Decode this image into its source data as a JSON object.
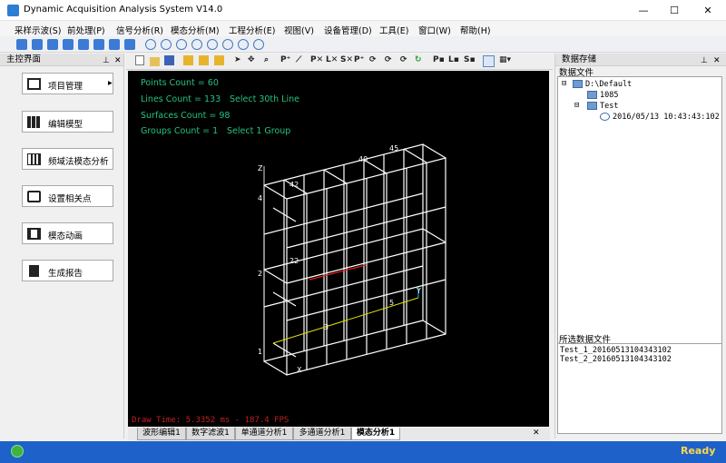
{
  "window": {
    "title": "Dynamic Acquisition Analysis System V14.0",
    "minimize": "—",
    "maximize": "☐",
    "close": "✕"
  },
  "menu": [
    "采样示波(S)",
    "前处理(P)",
    "信号分析(R)",
    "模态分析(M)",
    "工程分析(E)",
    "视图(V)",
    "设备管理(D)",
    "工具(E)",
    "窗口(W)",
    "帮助(H)"
  ],
  "left_panel": {
    "title": "主控界面",
    "pin": "⊥",
    "close": "✕",
    "buttons": [
      {
        "label": "项目管理",
        "icon": "project-icon",
        "arrow": "▸"
      },
      {
        "label": "编辑模型",
        "icon": "grid-icon"
      },
      {
        "label": "频域法模态分析",
        "icon": "bar-chart-icon"
      },
      {
        "label": "设置相关点",
        "icon": "edit-icon"
      },
      {
        "label": "模态动画",
        "icon": "film-icon"
      },
      {
        "label": "生成报告",
        "icon": "report-icon"
      }
    ]
  },
  "viewport": {
    "toolbar": [
      "P⁺",
      "P✕",
      "L✕",
      "S✕",
      "P⁺",
      "P▪",
      "L▪",
      "S▪"
    ],
    "stats": {
      "points": "Points Count = 60",
      "lines": "Lines Count = 133",
      "lines_select": "Select 30th Line",
      "surfaces": "Surfaces Count = 98",
      "groups": "Groups Count = 1",
      "groups_select": "Select 1 Group"
    },
    "axis_z": "Z",
    "axis_y": "Y",
    "axis_x": "X",
    "draw_time": "Draw Time: 5.3352 ms - 187.4 FPS",
    "node_labels": [
      "4",
      "2",
      "1",
      "3",
      "5",
      "45",
      "22",
      "42",
      "40"
    ]
  },
  "tabs": [
    {
      "label": "波形编辑1",
      "active": false
    },
    {
      "label": "数字滤波1",
      "active": false
    },
    {
      "label": "单通道分析1",
      "active": false
    },
    {
      "label": "多通道分析1",
      "active": false
    },
    {
      "label": "模态分析1",
      "active": true
    }
  ],
  "tabs_close": "✕",
  "right_panel": {
    "title": "数据存储",
    "subtitle": "数据文件",
    "pin": "⊥",
    "close": "✕",
    "tree": [
      {
        "label": "D:\\Default",
        "expander": "⊟"
      },
      {
        "label": "1085"
      },
      {
        "label": "Test",
        "expander": "⊟"
      },
      {
        "label": "2016/05/13 10:43:43:102"
      }
    ],
    "selected_title": "所选数据文件",
    "selected_files": [
      "Test_1_20160513104343102",
      "Test_2_20160513104343102"
    ]
  },
  "status": {
    "ready": "Ready"
  },
  "colors": {
    "accent": "#1e62c9",
    "stats_text": "#26c281",
    "draw_time": "#c22020",
    "ready": "#ffd84a"
  }
}
